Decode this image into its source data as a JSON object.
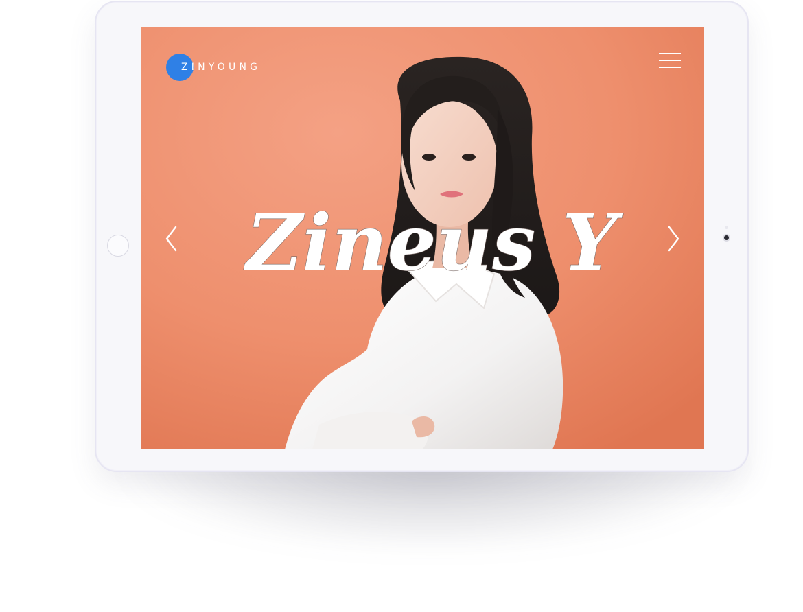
{
  "brand": {
    "logo_text": "ZINYOUNG",
    "accent_color": "#2f80e6"
  },
  "hero": {
    "title": "Zineus Y",
    "background_color": "#ee8e6b"
  },
  "navigation": {
    "menu_icon": "hamburger-menu-icon",
    "prev_icon": "chevron-left-icon",
    "next_icon": "chevron-right-icon"
  }
}
